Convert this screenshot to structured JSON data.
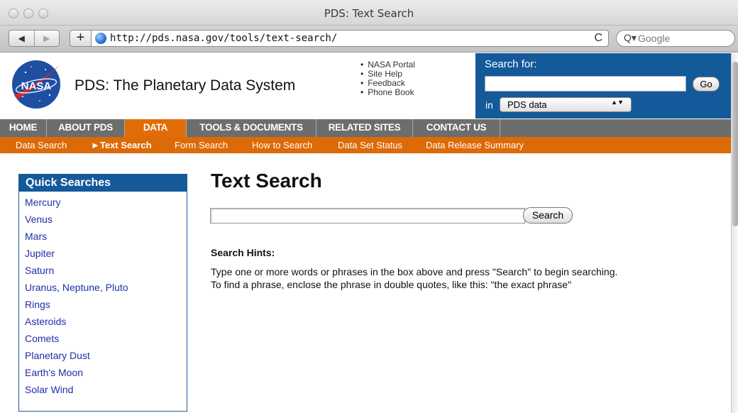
{
  "window": {
    "title": "PDS: Text Search"
  },
  "browser": {
    "back": "◀",
    "forward": "▶",
    "add": "+",
    "url": "http://pds.nasa.gov/tools/text-search/",
    "reload": "C",
    "search_icon": "Q▾",
    "search_placeholder": "Google"
  },
  "header": {
    "logo_text": "NASA",
    "site_title": "PDS: The Planetary Data System",
    "links": [
      "NASA Portal",
      "Site Help",
      "Feedback",
      "Phone Book"
    ],
    "search_label": "Search for:",
    "go_button": "Go",
    "in_label": "in",
    "scope_value": "PDS data",
    "scope_arrows": "▲▼"
  },
  "main_nav": [
    "HOME",
    "ABOUT PDS",
    "DATA",
    "TOOLS & DOCUMENTS",
    "RELATED SITES",
    "CONTACT US"
  ],
  "sub_nav": [
    "Data Search",
    "►Text Search",
    "Form Search",
    "How to Search",
    "Data Set Status",
    "Data Release Summary"
  ],
  "quick_searches": {
    "title": "Quick Searches",
    "items": [
      "Mercury",
      "Venus",
      "Mars",
      "Jupiter",
      "Saturn",
      "Uranus, Neptune, Pluto",
      "Rings",
      "Asteroids",
      "Comets",
      "Planetary Dust",
      "Earth's Moon",
      "Solar Wind"
    ]
  },
  "main": {
    "title": "Text Search",
    "search_button": "Search",
    "hints_title": "Search Hints:",
    "hint_lines": [
      "Type one or more words or phrases in the box above and press \"Search\" to begin searching.",
      "To find a phrase, enclose the phrase in double quotes, like this: \"the exact phrase\""
    ]
  },
  "colors": {
    "nasa_blue": "#14599a",
    "orange": "#dc6a06",
    "nav_gray": "#6d6d6d",
    "link_blue": "#1e2fa8"
  }
}
